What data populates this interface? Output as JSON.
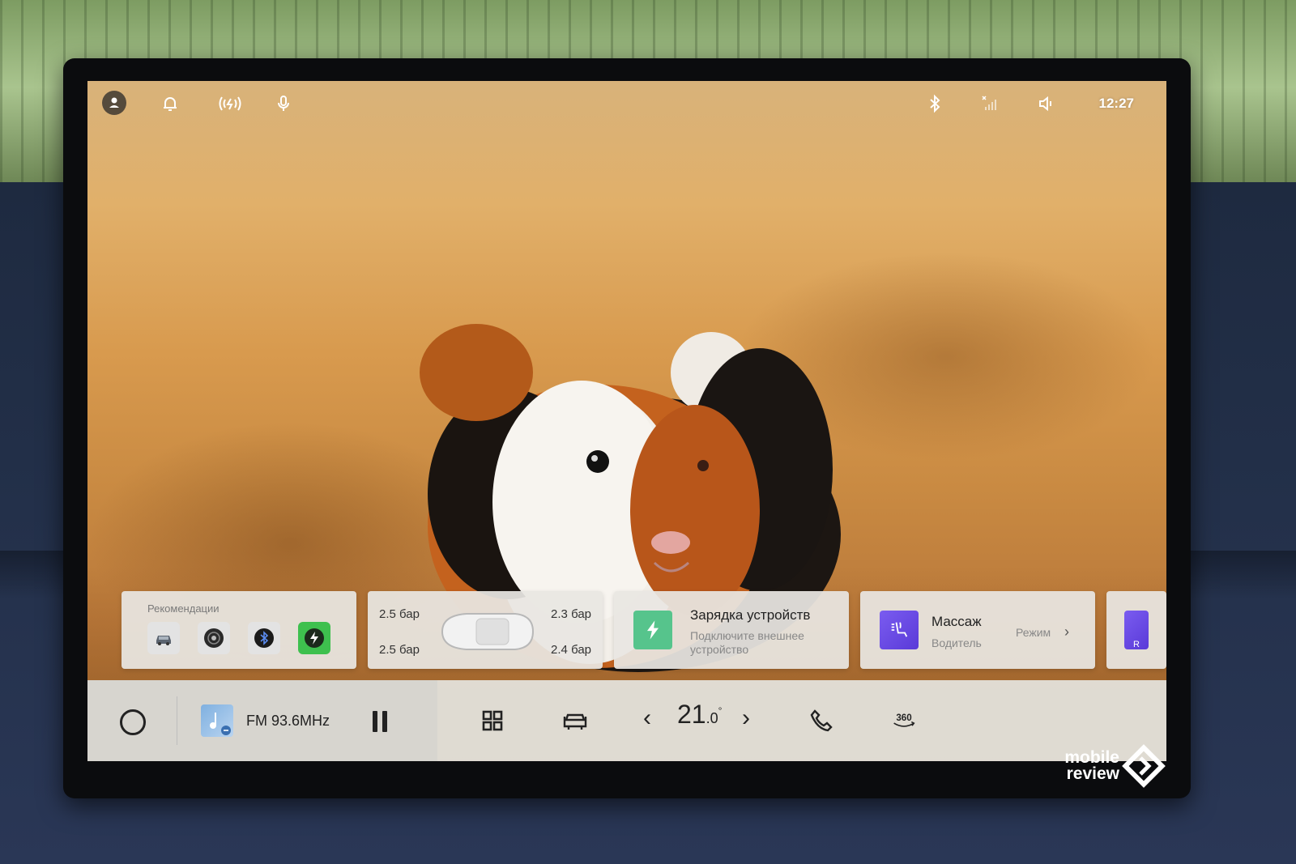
{
  "status_bar": {
    "time": "12:27",
    "icons": [
      "user-icon",
      "bell-icon",
      "wireless-charge-icon",
      "microphone-icon",
      "bluetooth-icon",
      "signal-off-icon",
      "volume-icon"
    ]
  },
  "cards": {
    "recommendations": {
      "title": "Рекомендации",
      "icons": [
        "car-icon",
        "speaker-icon",
        "bluetooth-icon",
        "charge-icon"
      ]
    },
    "tires": {
      "front_left": "2.5 бар",
      "front_right": "2.3 бар",
      "rear_left": "2.5 бар",
      "rear_right": "2.4 бар"
    },
    "charging": {
      "title": "Зарядка устройств",
      "subtitle": "Подключите внешнее устройство"
    },
    "massage": {
      "title": "Массаж",
      "subtitle": "Водитель",
      "mode_label": "Режим"
    },
    "extra": {
      "label": "R"
    }
  },
  "dock": {
    "radio_label": "FM 93.6MHz",
    "temperature_int": "21",
    "temperature_dec": ".0",
    "temperature_unit": "°",
    "camera_label": "360"
  },
  "watermark": {
    "line1": "mobile",
    "line2": "review"
  },
  "colors": {
    "card_bg": "#e8e6e2",
    "charge_green": "#56c48c",
    "rec_green": "#3ec04e",
    "massage_purple": "#6a4ae6",
    "dock_bg": "#e2e0da"
  }
}
